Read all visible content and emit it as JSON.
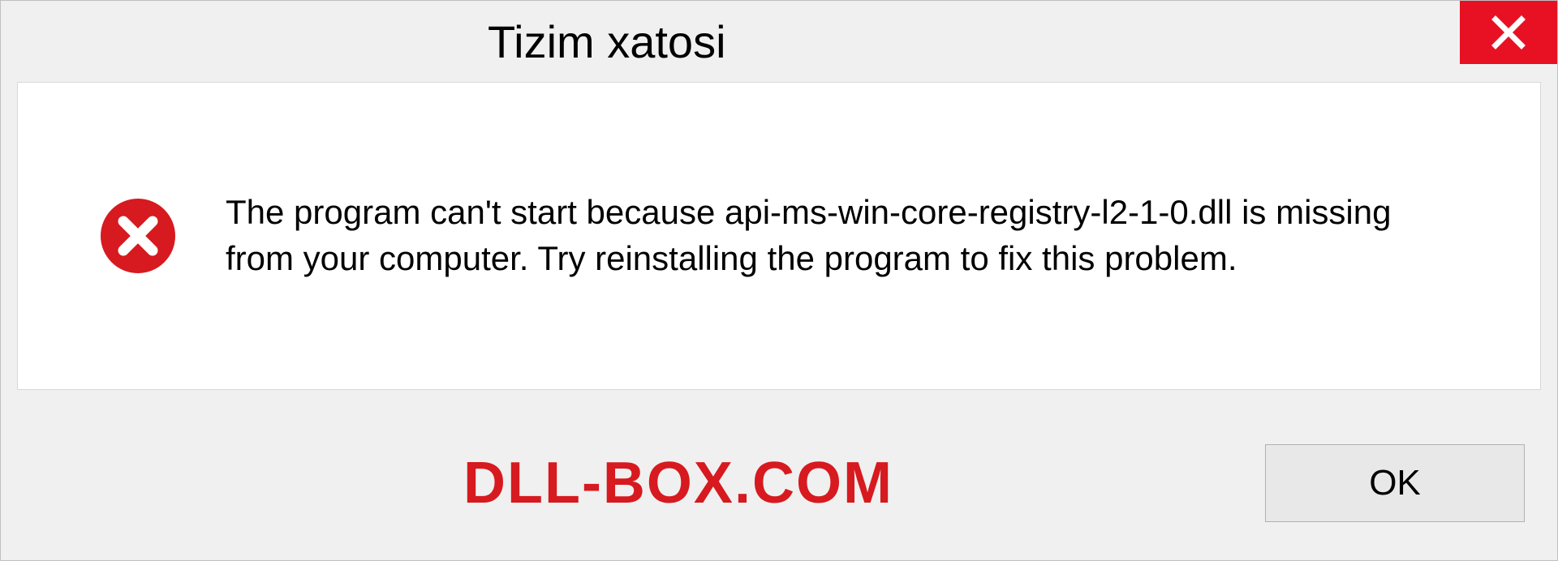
{
  "dialog": {
    "title": "Tizim xatosi",
    "message": "The program can't start because api-ms-win-core-registry-l2-1-0.dll is missing from your computer. Try reinstalling the program to fix this problem.",
    "ok_label": "OK",
    "watermark": "DLL-BOX.COM"
  },
  "colors": {
    "close_bg": "#e81123",
    "error_icon": "#d61a1f",
    "watermark": "#d61a1f"
  }
}
